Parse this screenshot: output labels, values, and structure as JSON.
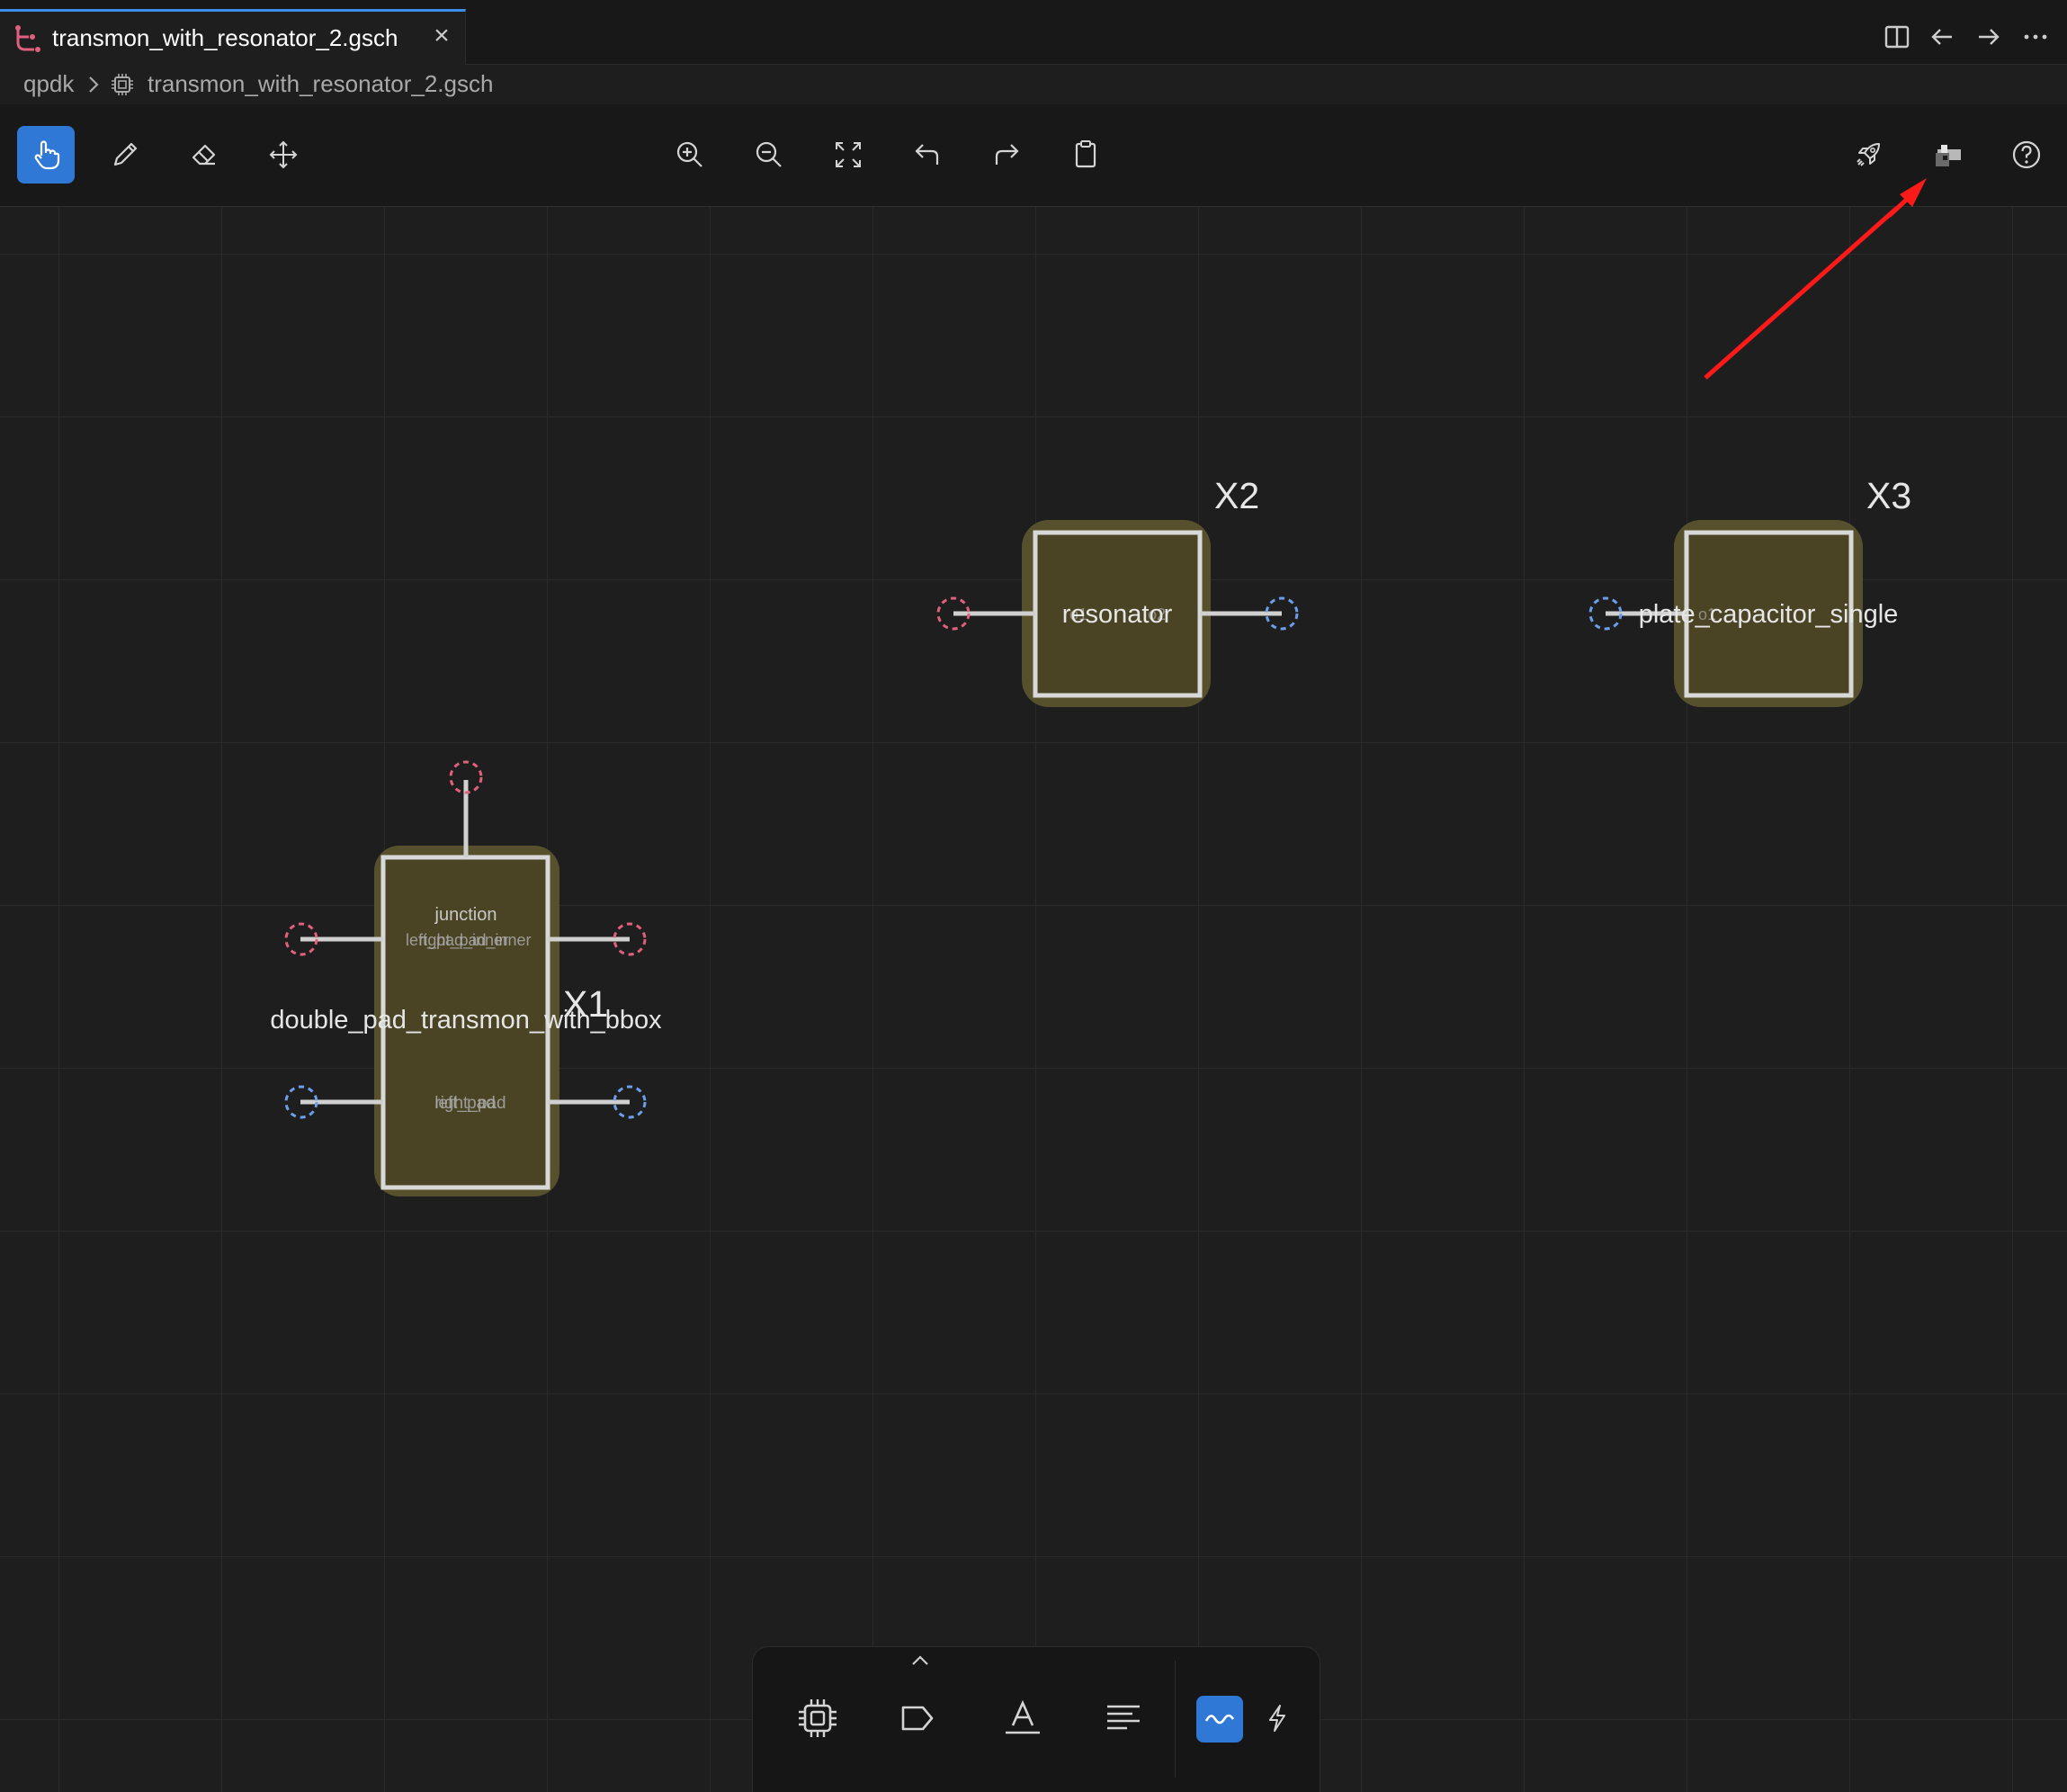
{
  "tab": {
    "title": "transmon_with_resonator_2.gsch",
    "close_label": "×",
    "file_icon": "schematic-branch-icon"
  },
  "editor_actions": {
    "icons": [
      "split-editor-icon",
      "go-back-icon",
      "go-forward-icon",
      "more-actions-icon"
    ]
  },
  "breadcrumb": {
    "items": [
      "qpdk",
      "transmon_with_resonator_2.gsch"
    ],
    "file_icon": "chip-icon",
    "separator_icon": "chevron-right-icon"
  },
  "toolbar": {
    "left_tools": [
      {
        "name": "select-tool",
        "icon": "hand-pointer-icon",
        "active": true
      },
      {
        "name": "draw-tool",
        "icon": "pencil-icon",
        "active": false
      },
      {
        "name": "erase-tool",
        "icon": "eraser-icon",
        "active": false
      },
      {
        "name": "move-tool",
        "icon": "move-arrows-icon",
        "active": false
      }
    ],
    "center_tools": [
      {
        "name": "zoom-in",
        "icon": "zoom-in-icon"
      },
      {
        "name": "zoom-out",
        "icon": "zoom-out-icon"
      },
      {
        "name": "fit-view",
        "icon": "fit-view-icon"
      },
      {
        "name": "undo",
        "icon": "undo-icon"
      },
      {
        "name": "redo",
        "icon": "redo-icon"
      },
      {
        "name": "clipboard",
        "icon": "clipboard-icon"
      }
    ],
    "right_tools": [
      {
        "name": "run",
        "icon": "rocket-icon"
      },
      {
        "name": "layout",
        "icon": "layout-block-icon"
      },
      {
        "name": "help",
        "icon": "help-circle-icon"
      }
    ]
  },
  "schematic": {
    "components": [
      {
        "ref": "X1",
        "name": "double_pad_transmon_with_bbox",
        "port_labels_top": [
          "junction",
          "left_pad_inner",
          "right_pad_inner"
        ],
        "port_labels_bottom": [
          "left_pad",
          "right_pad"
        ]
      },
      {
        "ref": "X2",
        "name": "resonator",
        "port_labels": [
          "o1",
          "o2"
        ]
      },
      {
        "ref": "X3",
        "name": "plate_capacitor_single",
        "port_labels": [
          "o1"
        ]
      }
    ],
    "colors": {
      "component_fill": "#4a4425",
      "component_halo": "#57502c",
      "component_border": "#d8d8d8",
      "wire": "#d0d0d0",
      "port_red": "#e0607e",
      "port_blue": "#6d9eea",
      "annotation_arrow": "#ff1a1a"
    },
    "annotation": {
      "type": "arrow",
      "points_to": "layout-block-icon"
    }
  },
  "palette": {
    "expand_icon": "chevron-up-icon",
    "tools": [
      {
        "name": "component",
        "icon": "chip-icon",
        "active": false
      },
      {
        "name": "net-label",
        "icon": "tag-icon",
        "active": false
      },
      {
        "name": "text",
        "icon": "text-icon",
        "active": false
      },
      {
        "name": "align",
        "icon": "align-left-icon",
        "active": false
      },
      {
        "name": "waveform",
        "icon": "wave-icon",
        "active": true
      },
      {
        "name": "power",
        "icon": "lightning-icon",
        "active": false
      }
    ]
  }
}
